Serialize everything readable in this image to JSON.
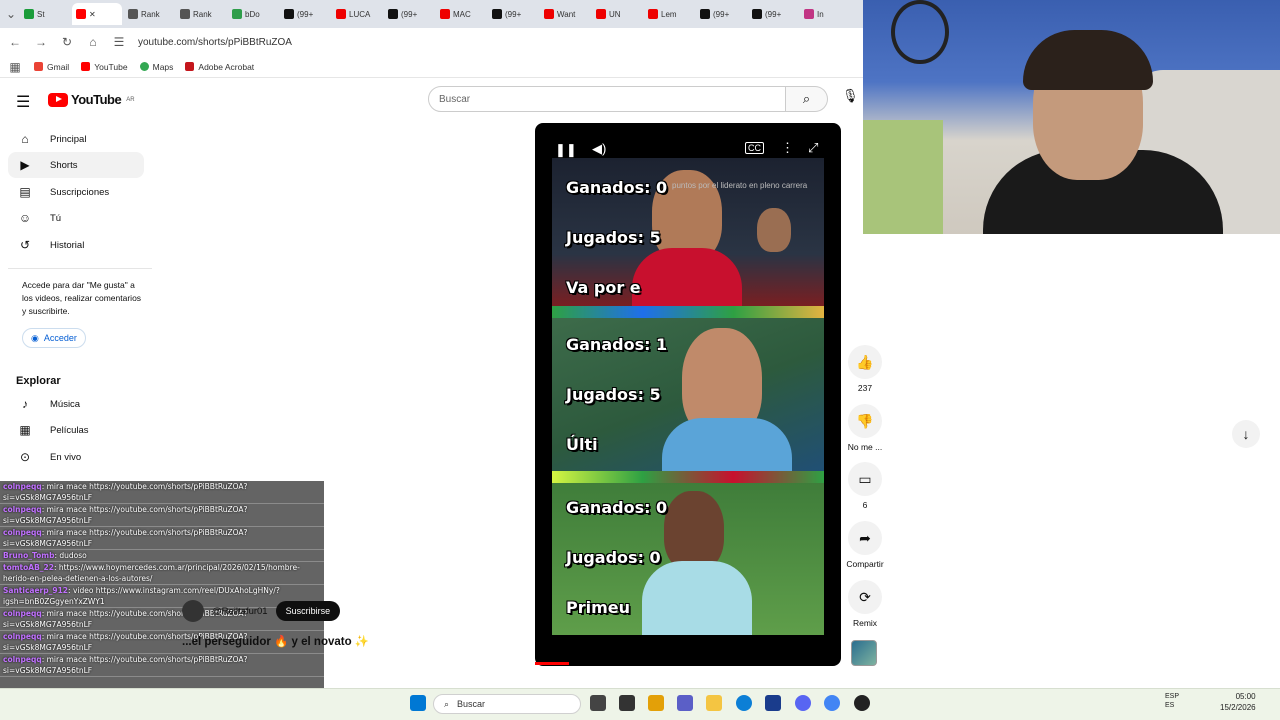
{
  "browser": {
    "tabs": [
      "St",
      "Rank",
      "Rank",
      "bDo",
      "(99+",
      "LUCA",
      "(99+",
      "MAC",
      "(99+",
      "Want",
      "UN",
      "Lem",
      "(99+",
      "(99+",
      "In"
    ],
    "url": "youtube.com/shorts/pPiBBtRuZOA",
    "bookmarks": [
      "Gmail",
      "YouTube",
      "Maps",
      "Adobe Acrobat"
    ]
  },
  "header": {
    "logo_text": "YouTube",
    "logo_region": "AR",
    "search_placeholder": "Buscar"
  },
  "sidebar": {
    "items": [
      {
        "label": "Principal",
        "icon": "home-icon"
      },
      {
        "label": "Shorts",
        "icon": "shorts-icon"
      },
      {
        "label": "Suscripciones",
        "icon": "subscriptions-icon"
      },
      {
        "label": "Tú",
        "icon": "you-icon"
      },
      {
        "label": "Historial",
        "icon": "history-icon"
      }
    ],
    "signin_text": "Accede para dar \"Me gusta\" a los videos, realizar comentarios y suscribirte.",
    "signin_button": "Acceder",
    "explore_title": "Explorar",
    "explore_items": [
      {
        "label": "Música",
        "icon": "music-icon"
      },
      {
        "label": "Películas",
        "icon": "movies-icon"
      },
      {
        "label": "En vivo",
        "icon": "live-icon"
      }
    ]
  },
  "chat": [
    {
      "user": "colnpeqq",
      "text": ": mira mace https://youtube.com/shorts/pPiBBtRuZOA? si=vGSk8MG7A956tnLF"
    },
    {
      "user": "colnpeqq",
      "text": ": mira mace https://youtube.com/shorts/pPiBBtRuZOA? si=vGSk8MG7A956tnLF"
    },
    {
      "user": "colnpeqq",
      "text": ": mira mace https://youtube.com/shorts/pPiBBtRuZOA? si=vGSk8MG7A956tnLF"
    },
    {
      "user": "Bruno_Tomb",
      "text": ": dudoso"
    },
    {
      "user": "tomtoAB_22",
      "text": ": https://www.hoymercedes.com.ar/principal/2026/02/15/hombre-herido-en-pelea-detienen-a-los-autores/"
    },
    {
      "user": "Santicaerp_912",
      "text": ": video https://www.instagram.com/reel/DUxAhoLgHNy/?igsh=bnB0ZGgyenYxZWY1"
    },
    {
      "user": "colnpeqq",
      "text": ": mira mace https://youtube.com/shorts/pPiBBtRuZOA? si=vGSk8MG7A956tnLF"
    },
    {
      "user": "colnpeqq",
      "text": ": mira mace https://youtube.com/shorts/pPiBBtRuZOA? si=vGSk8MG7A956tnLF"
    },
    {
      "user": "colnpeqq",
      "text": ": mira mace https://youtube.com/shorts/pPiBBtRuZOA? si=vGSk8MG7A956tnLF"
    }
  ],
  "player": {
    "overlay_caption": "puntos por el liderato en pleno carrera",
    "panels": [
      {
        "lines": [
          "Ganados: 0",
          "Jugados: 5",
          "Va por e"
        ]
      },
      {
        "lines": [
          "Ganados: 1",
          "Jugados: 5",
          "Últi"
        ]
      },
      {
        "lines": [
          "Ganados: 0",
          "Jugados: 0",
          "Primeu"
        ]
      }
    ]
  },
  "video": {
    "channel": "@Reiltafur01",
    "subscribe_label": "Suscribirse",
    "caption": "...el perseguidor 🔥 y el novato ✨"
  },
  "actions": [
    {
      "label": "237",
      "icon": "like-icon"
    },
    {
      "label": "No me ...",
      "icon": "dislike-icon"
    },
    {
      "label": "6",
      "icon": "comments-icon"
    },
    {
      "label": "Compartir",
      "icon": "share-icon"
    },
    {
      "label": "Remix",
      "icon": "remix-icon"
    }
  ],
  "taskbar": {
    "search_placeholder": "Buscar",
    "lang_1": "ESP",
    "lang_2": "ES",
    "time": "05:00",
    "date": "15/2/2026"
  }
}
